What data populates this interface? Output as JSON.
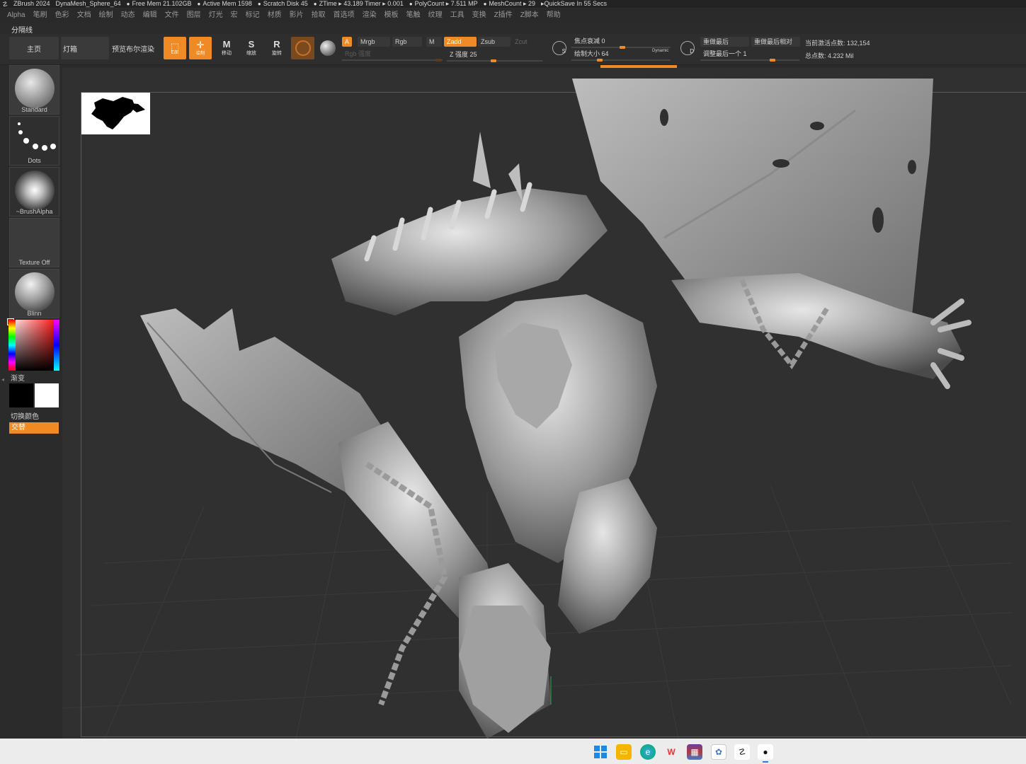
{
  "titlebar": {
    "app": "ZBrush 2024",
    "document": "DynaMesh_Sphere_64",
    "free_mem": "Free Mem 21.102GB",
    "active_mem": "Active Mem 1598",
    "scratch_disk": "Scratch Disk 45",
    "ztime": "ZTime ▸ 43.189 Timer ▸ 0.001",
    "polycount": "PolyCount ▸ 7.511 MP",
    "meshcount": "MeshCount ▸ 29",
    "quicksave": "▸QuickSave In 55 Secs"
  },
  "menubar": {
    "items": [
      "Alpha",
      "笔刷",
      "色彩",
      "文档",
      "绘制",
      "动态",
      "编辑",
      "文件",
      "图层",
      "灯光",
      "宏",
      "标记",
      "材质",
      "影片",
      "拾取",
      "首选项",
      "渲染",
      "模板",
      "笔触",
      "纹理",
      "工具",
      "变换",
      "Z插件",
      "Z脚本",
      "帮助"
    ]
  },
  "separator_label": "分隔线",
  "toolbar": {
    "home": "主页",
    "lightbox": "灯箱",
    "bpr_preview": "预览布尔渲染",
    "edit": "Edit",
    "draw": "绘制",
    "move": "移动",
    "scale": "缩放",
    "rotate": "旋转",
    "a_label": "A",
    "mrgb": "Mrgb",
    "rgb": "Rgb",
    "m": "M",
    "rgb_intensity": "Rgb 强度",
    "zadd": "Zadd",
    "zsub": "Zsub",
    "zcut": "Zcut",
    "z_intensity": "Z 强度 25",
    "z_intensity_value": 25,
    "focal_shift": "焦点衰减 0",
    "draw_size": "绘制大小 64",
    "dynamic": "Dynamic",
    "redo_last": "重做最后",
    "redo_last_relative": "重做最后相对",
    "adjust_last": "调整最后一个 1",
    "active_points": "当前激活点数: 132,154",
    "total_points": "总点数: 4.232 Mil",
    "s_glyph": "S",
    "d_glyph": "D"
  },
  "lefttray": {
    "brush": "Standard",
    "stroke": "Dots",
    "alpha": "~BrushAlpha",
    "texture": "Texture Off",
    "material": "Blinn",
    "gradient": "渐变",
    "switch_color": "切换颜色",
    "alternate": "交替"
  },
  "taskbar": {
    "icons": [
      "windows-start",
      "file-explorer",
      "edge",
      "wps",
      "winrar",
      "app-blue",
      "zbrush",
      "qq"
    ]
  },
  "colors": {
    "accent": "#f08a24",
    "viewport": "#303030",
    "panel": "#2b2b2b"
  }
}
